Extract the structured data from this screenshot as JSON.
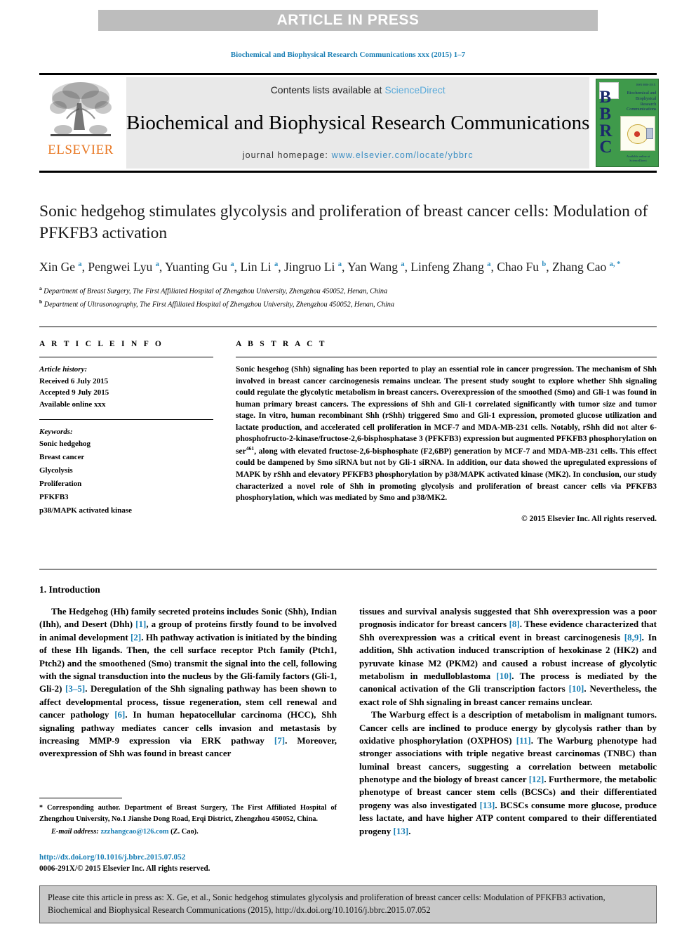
{
  "banner": {
    "label": "ARTICLE IN PRESS"
  },
  "running_head": "Biochemical and Biophysical Research Communications xxx (2015) 1–7",
  "masthead": {
    "contents_prefix": "Contents lists available at ",
    "sciencedirect": "ScienceDirect",
    "journal_title": "Biochemical and Biophysical Research Communications",
    "homepage_prefix": "journal homepage: ",
    "homepage_url": "www.elsevier.com/locate/ybbrc",
    "elsevier_word": "ELSEVIER",
    "cover": {
      "letters": "BBRC",
      "title": "Biochemical and Biophysical Research Communications",
      "issn": "ISSN 0006-291X",
      "footer": "Available online at\nScienceDirect"
    }
  },
  "article": {
    "title": "Sonic hedgehog stimulates glycolysis and proliferation of breast cancer cells: Modulation of PFKFB3 activation",
    "authors": [
      {
        "name": "Xin Ge",
        "mark": "a",
        "sep": ", "
      },
      {
        "name": "Pengwei Lyu",
        "mark": "a",
        "sep": ", "
      },
      {
        "name": "Yuanting Gu",
        "mark": "a",
        "sep": ", "
      },
      {
        "name": "Lin Li",
        "mark": "a",
        "sep": ", "
      },
      {
        "name": "Jingruo Li",
        "mark": "a",
        "sep": ", "
      },
      {
        "name": "Yan Wang",
        "mark": "a",
        "sep": ", "
      },
      {
        "name": "Linfeng Zhang",
        "mark": "a",
        "sep": ", "
      },
      {
        "name": "Chao Fu",
        "mark": "b",
        "sep": ", "
      },
      {
        "name": "Zhang Cao",
        "mark": "a, *",
        "sep": ""
      }
    ],
    "affiliations": [
      {
        "mark": "a",
        "text": "Department of Breast Surgery, The First Affiliated Hospital of Zhengzhou University, Zhengzhou 450052, Henan, China"
      },
      {
        "mark": "b",
        "text": "Department of Ultrasonography, The First Affiliated Hospital of Zhengzhou University, Zhengzhou 450052, Henan, China"
      }
    ]
  },
  "article_info": {
    "heading": "A R T I C L E   I N F O",
    "history_label": "Article history:",
    "history": [
      "Received 6 July 2015",
      "Accepted 9 July 2015",
      "Available online xxx"
    ],
    "keywords_label": "Keywords:",
    "keywords": [
      "Sonic hedgehog",
      "Breast cancer",
      "Glycolysis",
      "Proliferation",
      "PFKFB3",
      "p38/MAPK activated kinase"
    ]
  },
  "abstract": {
    "heading": "A B S T R A C T",
    "part1": "Sonic hesgehog (Shh) signaling has been reported to play an essential role in cancer progression. The mechanism of Shh involved in breast cancer carcinogenesis remains unclear. The present study sought to explore whether Shh signaling could regulate the glycolytic metabolism in breast cancers. Overexpression of the smoothed (Smo) and Gli-1 was found in human primary breast cancers. The expressions of Shh and Gli-1 correlated significantly with tumor size and tumor stage. In vitro, human recombinant Shh (rShh) triggered Smo and Gli-1 expression, promoted glucose utilization and lactate production, and accelerated cell proliferation in MCF-7 and MDA-MB-231 cells. Notably, rShh did not alter 6-phosphofructo-2-kinase/fructose-2,6-bisphosphatase 3 (PFKFB3) expression but augmented PFKFB3 phosphorylation on ser",
    "superscript": "461",
    "part2": ", along with elevated fructose-2,6-bisphosphate (F2,6BP) generation by MCF-7 and MDA-MB-231 cells. This effect could be dampened by Smo siRNA but not by Gli-1 siRNA. In addition, our data showed the upregulated expressions of MAPK by rShh and elevatory PFKFB3 phosphorylation by p38/MAPK activated kinase (MK2). In conclusion, our study characterized a novel role of Shh in promoting glycolysis and proliferation of breast cancer cells via PFKFB3 phosphorylation, which was mediated by Smo and p38/MK2.",
    "copyright": "© 2015 Elsevier Inc. All rights reserved."
  },
  "body": {
    "section_heading": "1. Introduction",
    "left_par_1_a": "The Hedgehog (Hh) family secreted proteins includes Sonic (Shh), Indian (Ihh), and Desert (Dhh) ",
    "left_ref_1": "[1]",
    "left_par_1_b": ", a group of proteins firstly found to be involved in animal development ",
    "left_ref_2": "[2]",
    "left_par_1_c": ". Hh pathway activation is initiated by the binding of these Hh ligands. Then, the cell surface receptor Ptch family (Ptch1, Ptch2) and the smoothened (Smo) transmit the signal into the cell, following with the signal transduction into the nucleus by the Gli-family factors (Gli-1, Gli-2) ",
    "left_ref_3": "[3–5]",
    "left_par_1_d": ". Deregulation of the Shh signaling pathway has been shown to affect developmental process, tissue regeneration, stem cell renewal and cancer pathology ",
    "left_ref_4": "[6]",
    "left_par_1_e": ". In human hepatocellular carcinoma (HCC), Shh signaling pathway mediates cancer cells invasion and metastasis by increasing MMP-9 expression via ERK pathway ",
    "left_ref_5": "[7]",
    "left_par_1_f": ". Moreover, overexpression of Shh was found in breast cancer",
    "right_par_1_a": "tissues and survival analysis suggested that Shh overexpression was a poor prognosis indicator for breast cancers ",
    "right_ref_1": "[8]",
    "right_par_1_b": ". These evidence characterized that Shh overexpression was a critical event in breast carcinogenesis ",
    "right_ref_2": "[8,9]",
    "right_par_1_c": ". In addition, Shh activation induced transcription of hexokinase 2 (HK2) and pyruvate kinase M2 (PKM2) and caused a robust increase of glycolytic metabolism in medulloblastoma ",
    "right_ref_3": "[10]",
    "right_par_1_d": ". The process is mediated by the canonical activation of the Gli transcription factors ",
    "right_ref_4": "[10]",
    "right_par_1_e": ". Nevertheless, the exact role of Shh signaling in breast cancer remains unclear.",
    "right_par_2_a": "The Warburg effect is a description of metabolism in malignant tumors. Cancer cells are inclined to produce energy by glycolysis rather than by oxidative phosphorylation (OXPHOS) ",
    "right_ref_5": "[11]",
    "right_par_2_b": ". The Warburg phenotype had stronger associations with triple negative breast carcinomas (TNBC) than luminal breast cancers, suggesting a correlation between metabolic phenotype and the biology of breast cancer ",
    "right_ref_6": "[12]",
    "right_par_2_c": ". Furthermore, the metabolic phenotype of breast cancer stem cells (BCSCs) and their differentiated progeny was also investigated ",
    "right_ref_7": "[13]",
    "right_par_2_d": ". BCSCs consume more glucose, produce less lactate, and have higher ATP content compared to their differentiated progeny ",
    "right_ref_8": "[13]",
    "right_par_2_e": "."
  },
  "footnote": {
    "star": "*",
    "text": " Corresponding author. Department of Breast Surgery, The First Affiliated Hospital of Zhengzhou University, No.1 Jianshe Dong Road, Erqi District, Zhengzhou 450052, China.",
    "email_label": "E-mail address:",
    "email": "zzzhangcao@126.com",
    "email_suffix": "(Z. Cao).",
    "doi": "http://dx.doi.org/10.1016/j.bbrc.2015.07.052",
    "issn_copyright": "0006-291X/© 2015 Elsevier Inc. All rights reserved."
  },
  "cite_box": {
    "text": "Please cite this article in press as: X. Ge, et al., Sonic hedgehog stimulates glycolysis and proliferation of breast cancer cells: Modulation of PFKFB3 activation, Biochemical and Biophysical Research Communications (2015), http://dx.doi.org/10.1016/j.bbrc.2015.07.052"
  },
  "colors": {
    "link_blue": "#1a7fb5",
    "sciencedirect_blue": "#5aaada",
    "elsevier_orange": "#E87722",
    "banner_grey": "#bdbdbd",
    "cover_green": "#3f9a4b",
    "cite_box_grey": "#c9c9c9"
  }
}
